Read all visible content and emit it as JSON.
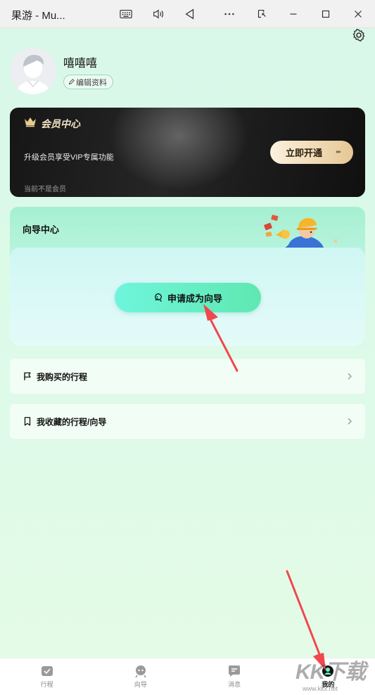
{
  "window": {
    "title": "果游 - Mu...",
    "controls": [
      "keyboard-icon",
      "volume-icon",
      "back-triangle-icon",
      "more-icon",
      "restore-screen-icon",
      "minimize-icon",
      "maximize-icon",
      "close-icon"
    ]
  },
  "profile": {
    "username": "嘻嘻嘻",
    "edit_label": "编辑资料"
  },
  "vip": {
    "title": "会员中心",
    "description": "升级会员享受VIP专属功能",
    "button_label": "立即开通",
    "status": "当前不是会员",
    "accent_color": "#e6c794"
  },
  "guide": {
    "title": "向导中心",
    "apply_label": "申请成为向导"
  },
  "list": {
    "purchased_trips": "我购买的行程",
    "favorites": "我收藏的行程/向导"
  },
  "bottom_nav": {
    "items": [
      {
        "label": "行程",
        "icon": "trip-icon"
      },
      {
        "label": "向导",
        "icon": "guide-icon"
      },
      {
        "label": "消息",
        "icon": "message-icon"
      },
      {
        "label": "我的",
        "icon": "profile-icon"
      }
    ],
    "active": "我的"
  },
  "watermark": {
    "text": "KK下载",
    "url": "www.kkx.net"
  },
  "colors": {
    "background": "#dcfae8",
    "annotation_arrow": "#f0484e"
  }
}
